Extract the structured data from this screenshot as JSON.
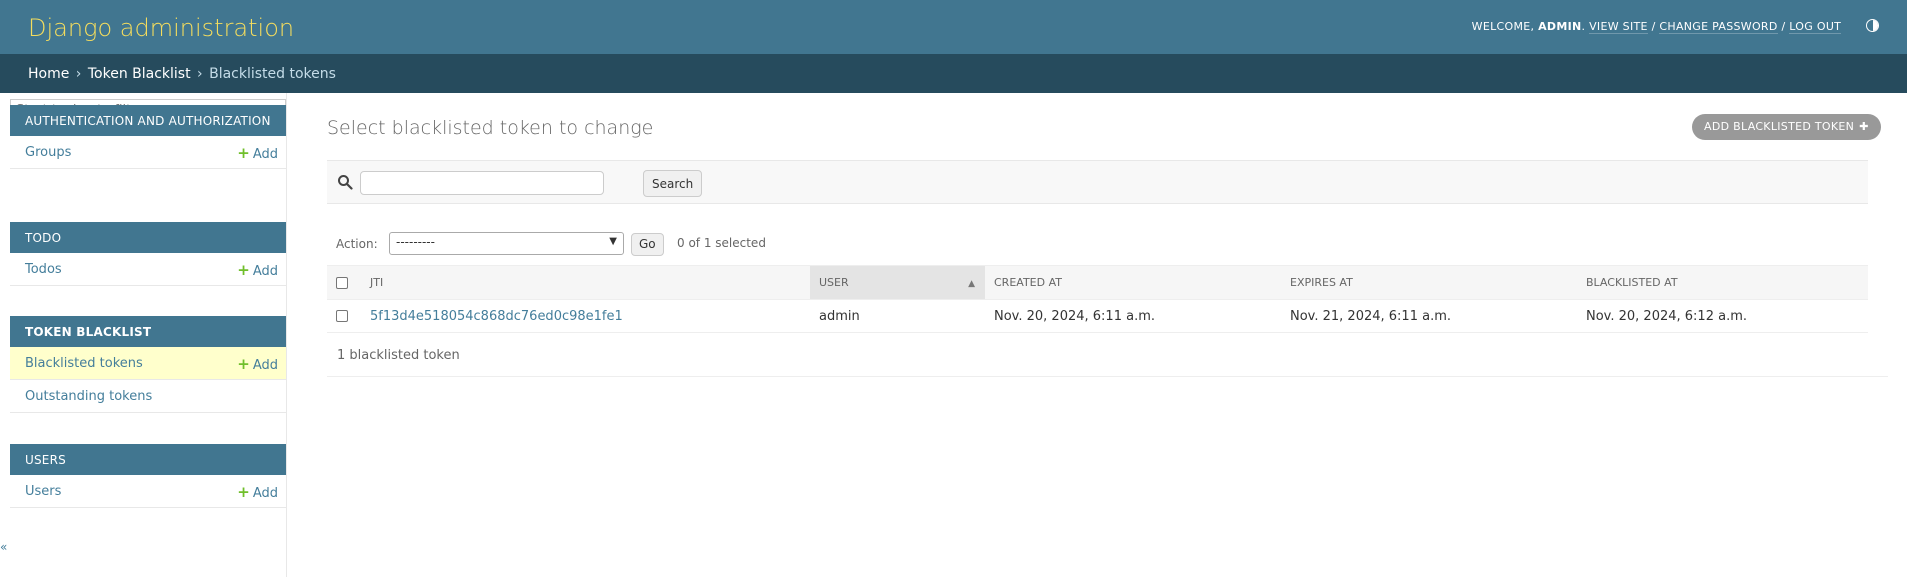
{
  "header": {
    "branding": "Django administration",
    "welcome": "WELCOME,",
    "user": "ADMIN",
    "view_site": "VIEW SITE",
    "change_password": "CHANGE PASSWORD",
    "log_out": "LOG OUT",
    "theme_icon": "half-circle-icon"
  },
  "breadcrumbs": {
    "home": "Home",
    "app": "Token Blacklist",
    "current": "Blacklisted tokens",
    "separator": "›"
  },
  "sidebar": {
    "filter_placeholder": "Start typing to filter...",
    "add_label": "Add",
    "modules": [
      {
        "caption": "Authentication and Authorization",
        "models": [
          {
            "name": "Groups",
            "add": true
          }
        ]
      },
      {
        "caption": "Todo",
        "models": [
          {
            "name": "Todos",
            "add": true
          }
        ]
      },
      {
        "caption": "Token Blacklist",
        "current": true,
        "models": [
          {
            "name": "Blacklisted tokens",
            "add": true,
            "current": true
          },
          {
            "name": "Outstanding tokens",
            "add": false
          }
        ]
      },
      {
        "caption": "Users",
        "models": [
          {
            "name": "Users",
            "add": true
          }
        ]
      }
    ],
    "collapse_icon": "«"
  },
  "content": {
    "title": "Select blacklisted token to change",
    "add_button": "ADD BLACKLISTED TOKEN",
    "search_button": "Search",
    "search_value": "",
    "action_label": "Action:",
    "action_selected": "---------",
    "go_button": "Go",
    "action_counter": "0 of 1 selected",
    "columns": [
      "JTI",
      "USER",
      "CREATED AT",
      "EXPIRES AT",
      "BLACKLISTED AT"
    ],
    "sorted_column": "USER",
    "rows": [
      {
        "jti": "5f13d4e518054c868dc76ed0c98e1fe1",
        "user": "admin",
        "created_at": "Nov. 20, 2024, 6:11 a.m.",
        "expires_at": "Nov. 21, 2024, 6:11 a.m.",
        "blacklisted_at": "Nov. 20, 2024, 6:12 a.m."
      }
    ],
    "paginator": "1 blacklisted token"
  },
  "colors": {
    "header_bg": "#417690",
    "breadcrumbs_bg": "#264b5d",
    "branding": "#f5dd5d",
    "link": "#447e9b",
    "current_row": "#ffffcc",
    "add_plus": "#70bf2b"
  }
}
